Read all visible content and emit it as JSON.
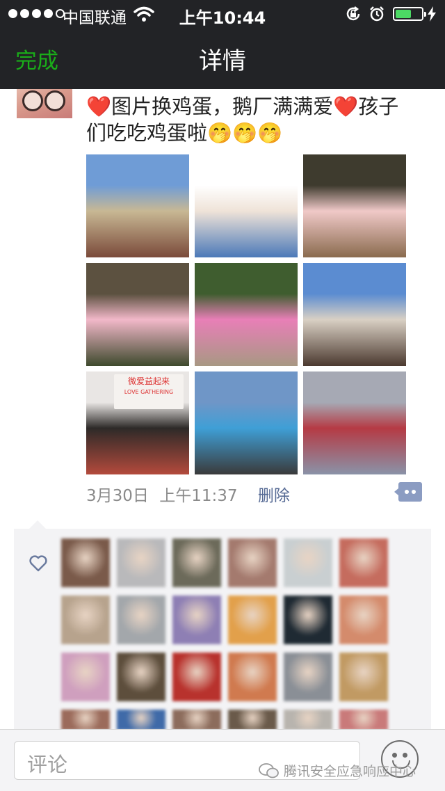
{
  "status_bar": {
    "carrier": "中国联通",
    "time": "上午10:44",
    "signal_bars_filled": 4,
    "signal_bars_total": 5,
    "battery_level": 0.6,
    "icons": [
      "wifi-icon",
      "rotation-lock-icon",
      "alarm-icon",
      "battery-icon",
      "charging-bolt-icon"
    ]
  },
  "nav": {
    "done_label": "完成",
    "title": "详情"
  },
  "post": {
    "text_line1_prefix": "❤️",
    "text_line1": "图片换鸡蛋，鹅厂满满爱",
    "text_line1_suffix_heart": "❤️",
    "text_line1_tail": "孩子",
    "text_line2": "们吃吃鸡蛋啦🤭🤭🤭",
    "photo_count": 9,
    "photos": [
      {
        "id": "p1",
        "colors": [
          "#6f9cd6",
          "#c8b894",
          "#7a4a3a"
        ]
      },
      {
        "id": "p2",
        "colors": [
          "#ffffff",
          "#efe3d8",
          "#4b79b8"
        ]
      },
      {
        "id": "p3",
        "colors": [
          "#3e3b2e",
          "#f0c9c8",
          "#8a6b4e"
        ]
      },
      {
        "id": "p4",
        "colors": [
          "#5c5140",
          "#f2b8c9",
          "#3e4a2d"
        ]
      },
      {
        "id": "p5",
        "colors": [
          "#3f5d2f",
          "#e87fb7",
          "#a89883"
        ]
      },
      {
        "id": "p6",
        "colors": [
          "#5b8cd1",
          "#d9d0c4",
          "#4c3a30"
        ]
      },
      {
        "id": "p7",
        "colors": [
          "#e9e6e4",
          "#2d2a28",
          "#b44a3c"
        ]
      },
      {
        "id": "p8",
        "colors": [
          "#6f96c7",
          "#3f9fd6",
          "#3a3a3a"
        ]
      },
      {
        "id": "p9",
        "colors": [
          "#a6a9b4",
          "#b53a44",
          "#8a93a8"
        ]
      }
    ],
    "banner_text_photo7": "微爱益起来",
    "banner_sub_photo7": "LOVE GATHERING",
    "date": "3月30日",
    "time": "上午11:37",
    "delete_label": "删除"
  },
  "likes": {
    "avatar_colors": [
      "#7a5a4a",
      "#b9b9bb",
      "#6c6a5a",
      "#a47a6e",
      "#c9cfd1",
      "#c56c5e",
      "#b7a38d",
      "#a3a7ab",
      "#8e7fb4",
      "#e2a04b",
      "#1f2a33",
      "#d48b6c",
      "#cf9fbe",
      "#5d4e3c",
      "#b8322d",
      "#d07a4f",
      "#8a8f96",
      "#c19a63",
      "#9b6b5b",
      "#3f6aa8",
      "#8c6c5c",
      "#6a5a4a",
      "#b8b4ae",
      "#c97a7a"
    ]
  },
  "input": {
    "placeholder": "评论"
  },
  "watermark": "腾讯安全应急响应中心",
  "colors": {
    "nav_bg": "#222326",
    "accent_green": "#1aad19",
    "link_blue": "#576b95"
  }
}
